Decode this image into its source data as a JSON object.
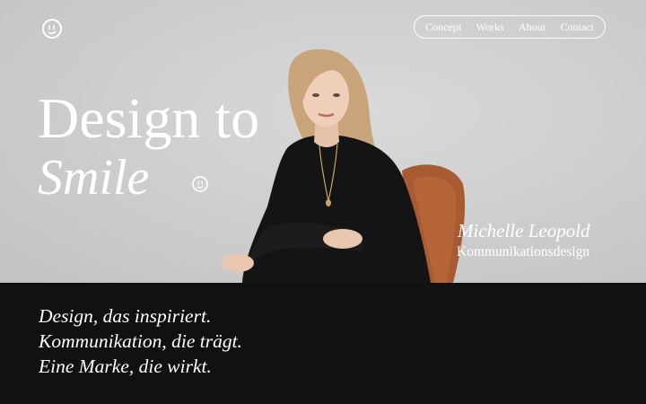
{
  "brand": {
    "logo_icon": "smiley-circle-icon"
  },
  "nav": {
    "items": [
      "Concept",
      "Works",
      "About",
      "Contact"
    ]
  },
  "hero": {
    "headline_line1": "Design to",
    "headline_line2": "Smile",
    "person_name": "Michelle Leopold",
    "person_role": "Kommunikationsdesign"
  },
  "taglines": [
    "Design, das inspiriert.",
    "Kommunikation, die trägt.",
    "Eine Marke, die wirkt."
  ],
  "colors": {
    "hero_bg": "#cfcfd0",
    "dark_bg": "#111111",
    "text": "#ffffff",
    "chair": "#a85a32",
    "hair": "#c9a47a",
    "sweater": "#141414"
  }
}
